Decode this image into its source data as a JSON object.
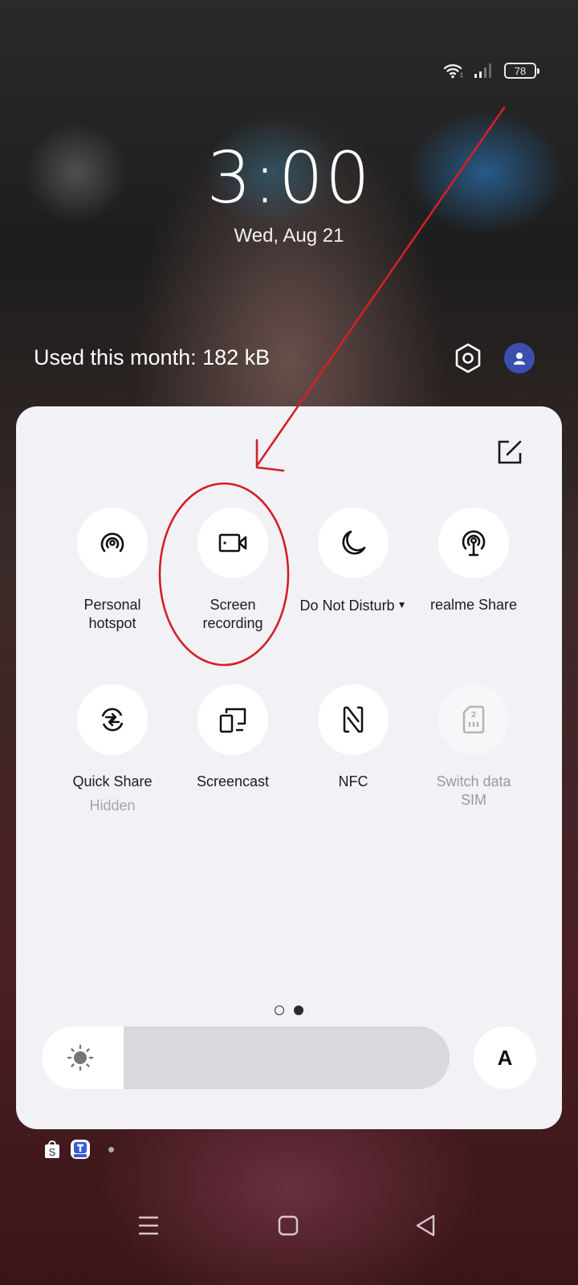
{
  "status_bar": {
    "wifi_icon": "wifi-icon",
    "signal_icon": "cell-signal-icon",
    "battery_level": "78"
  },
  "lockscreen": {
    "time": "3:00",
    "date": "Wed, Aug 21"
  },
  "header": {
    "data_usage": "Used this month: 182 kB",
    "settings_icon": "settings-icon",
    "user_icon": "user-avatar-icon"
  },
  "quick_settings": {
    "edit_icon": "edit-icon",
    "tiles": [
      {
        "label": "Personal\nhotspot",
        "icon": "hotspot-icon",
        "enabled": true
      },
      {
        "label": "Screen\nrecording",
        "icon": "screen-record-icon",
        "enabled": true
      },
      {
        "label": "Do Not Disturb",
        "icon": "moon-icon",
        "enabled": true,
        "has_dropdown": true
      },
      {
        "label": "realme Share",
        "icon": "realme-share-icon",
        "enabled": true
      },
      {
        "label": "Quick Share",
        "sub_label": "Hidden",
        "icon": "quick-share-icon",
        "enabled": true
      },
      {
        "label": "Screencast",
        "icon": "screencast-icon",
        "enabled": true
      },
      {
        "label": "NFC",
        "icon": "nfc-icon",
        "enabled": true
      },
      {
        "label": "Switch data\nSIM",
        "icon": "sim-2-icon",
        "enabled": false
      }
    ],
    "pager": {
      "pages": 2,
      "current": 2
    },
    "brightness": {
      "level": 0.2,
      "icon": "sun-icon"
    },
    "auto_brightness_label": "A"
  },
  "notifications": {
    "icons": [
      "shopee-icon",
      "app-t-icon"
    ],
    "more_dot": true
  },
  "navbar": {
    "buttons": [
      "menu",
      "home",
      "back"
    ]
  },
  "annotation": {
    "color": "#d32027"
  }
}
